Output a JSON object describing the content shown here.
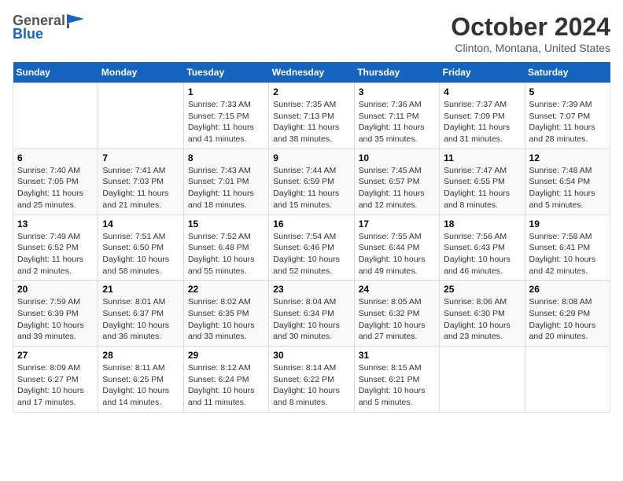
{
  "logo": {
    "general": "General",
    "blue": "Blue"
  },
  "title": "October 2024",
  "location": "Clinton, Montana, United States",
  "weekdays": [
    "Sunday",
    "Monday",
    "Tuesday",
    "Wednesday",
    "Thursday",
    "Friday",
    "Saturday"
  ],
  "weeks": [
    [
      {
        "day": "",
        "sunrise": "",
        "sunset": "",
        "daylight": ""
      },
      {
        "day": "",
        "sunrise": "",
        "sunset": "",
        "daylight": ""
      },
      {
        "day": "1",
        "sunrise": "Sunrise: 7:33 AM",
        "sunset": "Sunset: 7:15 PM",
        "daylight": "Daylight: 11 hours and 41 minutes."
      },
      {
        "day": "2",
        "sunrise": "Sunrise: 7:35 AM",
        "sunset": "Sunset: 7:13 PM",
        "daylight": "Daylight: 11 hours and 38 minutes."
      },
      {
        "day": "3",
        "sunrise": "Sunrise: 7:36 AM",
        "sunset": "Sunset: 7:11 PM",
        "daylight": "Daylight: 11 hours and 35 minutes."
      },
      {
        "day": "4",
        "sunrise": "Sunrise: 7:37 AM",
        "sunset": "Sunset: 7:09 PM",
        "daylight": "Daylight: 11 hours and 31 minutes."
      },
      {
        "day": "5",
        "sunrise": "Sunrise: 7:39 AM",
        "sunset": "Sunset: 7:07 PM",
        "daylight": "Daylight: 11 hours and 28 minutes."
      }
    ],
    [
      {
        "day": "6",
        "sunrise": "Sunrise: 7:40 AM",
        "sunset": "Sunset: 7:05 PM",
        "daylight": "Daylight: 11 hours and 25 minutes."
      },
      {
        "day": "7",
        "sunrise": "Sunrise: 7:41 AM",
        "sunset": "Sunset: 7:03 PM",
        "daylight": "Daylight: 11 hours and 21 minutes."
      },
      {
        "day": "8",
        "sunrise": "Sunrise: 7:43 AM",
        "sunset": "Sunset: 7:01 PM",
        "daylight": "Daylight: 11 hours and 18 minutes."
      },
      {
        "day": "9",
        "sunrise": "Sunrise: 7:44 AM",
        "sunset": "Sunset: 6:59 PM",
        "daylight": "Daylight: 11 hours and 15 minutes."
      },
      {
        "day": "10",
        "sunrise": "Sunrise: 7:45 AM",
        "sunset": "Sunset: 6:57 PM",
        "daylight": "Daylight: 11 hours and 12 minutes."
      },
      {
        "day": "11",
        "sunrise": "Sunrise: 7:47 AM",
        "sunset": "Sunset: 6:55 PM",
        "daylight": "Daylight: 11 hours and 8 minutes."
      },
      {
        "day": "12",
        "sunrise": "Sunrise: 7:48 AM",
        "sunset": "Sunset: 6:54 PM",
        "daylight": "Daylight: 11 hours and 5 minutes."
      }
    ],
    [
      {
        "day": "13",
        "sunrise": "Sunrise: 7:49 AM",
        "sunset": "Sunset: 6:52 PM",
        "daylight": "Daylight: 11 hours and 2 minutes."
      },
      {
        "day": "14",
        "sunrise": "Sunrise: 7:51 AM",
        "sunset": "Sunset: 6:50 PM",
        "daylight": "Daylight: 10 hours and 58 minutes."
      },
      {
        "day": "15",
        "sunrise": "Sunrise: 7:52 AM",
        "sunset": "Sunset: 6:48 PM",
        "daylight": "Daylight: 10 hours and 55 minutes."
      },
      {
        "day": "16",
        "sunrise": "Sunrise: 7:54 AM",
        "sunset": "Sunset: 6:46 PM",
        "daylight": "Daylight: 10 hours and 52 minutes."
      },
      {
        "day": "17",
        "sunrise": "Sunrise: 7:55 AM",
        "sunset": "Sunset: 6:44 PM",
        "daylight": "Daylight: 10 hours and 49 minutes."
      },
      {
        "day": "18",
        "sunrise": "Sunrise: 7:56 AM",
        "sunset": "Sunset: 6:43 PM",
        "daylight": "Daylight: 10 hours and 46 minutes."
      },
      {
        "day": "19",
        "sunrise": "Sunrise: 7:58 AM",
        "sunset": "Sunset: 6:41 PM",
        "daylight": "Daylight: 10 hours and 42 minutes."
      }
    ],
    [
      {
        "day": "20",
        "sunrise": "Sunrise: 7:59 AM",
        "sunset": "Sunset: 6:39 PM",
        "daylight": "Daylight: 10 hours and 39 minutes."
      },
      {
        "day": "21",
        "sunrise": "Sunrise: 8:01 AM",
        "sunset": "Sunset: 6:37 PM",
        "daylight": "Daylight: 10 hours and 36 minutes."
      },
      {
        "day": "22",
        "sunrise": "Sunrise: 8:02 AM",
        "sunset": "Sunset: 6:35 PM",
        "daylight": "Daylight: 10 hours and 33 minutes."
      },
      {
        "day": "23",
        "sunrise": "Sunrise: 8:04 AM",
        "sunset": "Sunset: 6:34 PM",
        "daylight": "Daylight: 10 hours and 30 minutes."
      },
      {
        "day": "24",
        "sunrise": "Sunrise: 8:05 AM",
        "sunset": "Sunset: 6:32 PM",
        "daylight": "Daylight: 10 hours and 27 minutes."
      },
      {
        "day": "25",
        "sunrise": "Sunrise: 8:06 AM",
        "sunset": "Sunset: 6:30 PM",
        "daylight": "Daylight: 10 hours and 23 minutes."
      },
      {
        "day": "26",
        "sunrise": "Sunrise: 8:08 AM",
        "sunset": "Sunset: 6:29 PM",
        "daylight": "Daylight: 10 hours and 20 minutes."
      }
    ],
    [
      {
        "day": "27",
        "sunrise": "Sunrise: 8:09 AM",
        "sunset": "Sunset: 6:27 PM",
        "daylight": "Daylight: 10 hours and 17 minutes."
      },
      {
        "day": "28",
        "sunrise": "Sunrise: 8:11 AM",
        "sunset": "Sunset: 6:25 PM",
        "daylight": "Daylight: 10 hours and 14 minutes."
      },
      {
        "day": "29",
        "sunrise": "Sunrise: 8:12 AM",
        "sunset": "Sunset: 6:24 PM",
        "daylight": "Daylight: 10 hours and 11 minutes."
      },
      {
        "day": "30",
        "sunrise": "Sunrise: 8:14 AM",
        "sunset": "Sunset: 6:22 PM",
        "daylight": "Daylight: 10 hours and 8 minutes."
      },
      {
        "day": "31",
        "sunrise": "Sunrise: 8:15 AM",
        "sunset": "Sunset: 6:21 PM",
        "daylight": "Daylight: 10 hours and 5 minutes."
      },
      {
        "day": "",
        "sunrise": "",
        "sunset": "",
        "daylight": ""
      },
      {
        "day": "",
        "sunrise": "",
        "sunset": "",
        "daylight": ""
      }
    ]
  ]
}
